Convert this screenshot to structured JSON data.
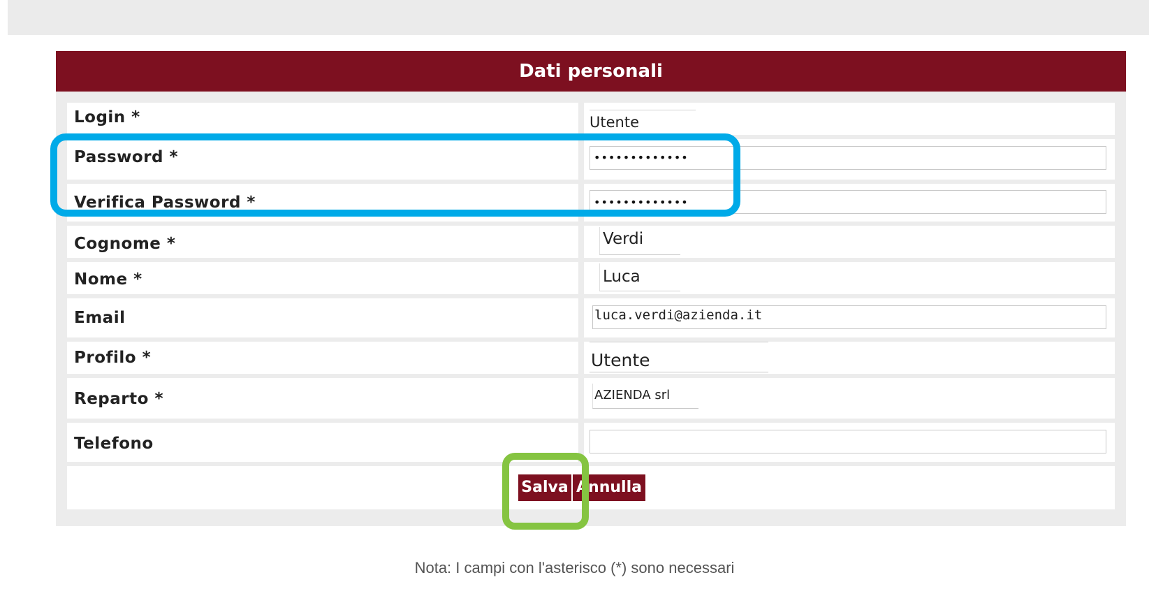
{
  "form": {
    "title": "Dati personali",
    "fields": {
      "login": {
        "label": "Login *",
        "value": "Utente"
      },
      "password": {
        "label": "Password *",
        "value": "•••••••••••••"
      },
      "verify_password": {
        "label": "Verifica Password *",
        "value": "•••••••••••••"
      },
      "cognome": {
        "label": "Cognome *",
        "value": "Verdi"
      },
      "nome": {
        "label": "Nome *",
        "value": "Luca"
      },
      "email": {
        "label": "Email",
        "value": "luca.verdi@azienda.it"
      },
      "profilo": {
        "label": "Profilo *",
        "value": "Utente"
      },
      "reparto": {
        "label": "Reparto *",
        "value": "AZIENDA srl"
      },
      "telefono": {
        "label": "Telefono",
        "value": ""
      }
    },
    "buttons": {
      "save": "Salva",
      "cancel": "Annulla"
    }
  },
  "note": "Nota: I campi con l'asterisco (*) sono necessari",
  "colors": {
    "header": "#7d1020",
    "highlight_password": "#00aae8",
    "highlight_save": "#85c441"
  }
}
